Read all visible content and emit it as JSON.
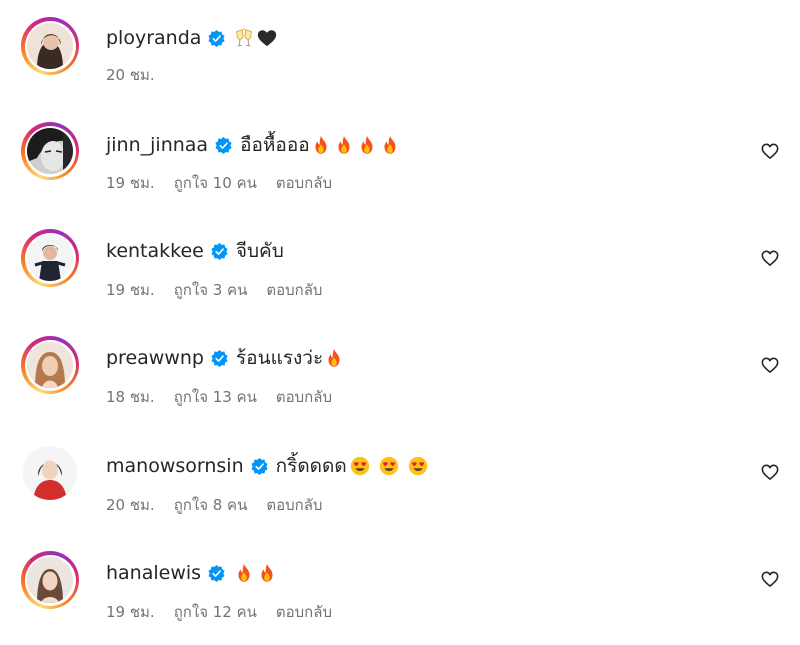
{
  "comments": [
    {
      "username": "ployranda",
      "verified": true,
      "text": "",
      "emojis": [
        "clinking-glasses",
        "black-heart"
      ],
      "time": "20 ชม.",
      "likes": "",
      "reply": "",
      "story_ring": true,
      "has_heart": false
    },
    {
      "username": "jinn_jinnaa",
      "verified": true,
      "text": "อือหื้อออ",
      "emojis": [
        "fire",
        "fire",
        "fire",
        "fire"
      ],
      "time": "19 ชม.",
      "likes": "ถูกใจ 10 คน",
      "reply": "ตอบกลับ",
      "story_ring": true,
      "has_heart": true
    },
    {
      "username": "kentakkee",
      "verified": true,
      "text": "จีบคับ",
      "emojis": [],
      "time": "19 ชม.",
      "likes": "ถูกใจ 3 คน",
      "reply": "ตอบกลับ",
      "story_ring": true,
      "has_heart": true
    },
    {
      "username": "preawwnp",
      "verified": true,
      "text": "ร้อนแรงว่ะ",
      "emojis": [
        "fire"
      ],
      "time": "18 ชม.",
      "likes": "ถูกใจ 13 คน",
      "reply": "ตอบกลับ",
      "story_ring": true,
      "has_heart": true
    },
    {
      "username": "manowsornsin",
      "verified": true,
      "text": "กริ้ดดดด",
      "emojis": [
        "heart-eyes",
        "heart-eyes",
        "heart-eyes"
      ],
      "time": "20 ชม.",
      "likes": "ถูกใจ 8 คน",
      "reply": "ตอบกลับ",
      "story_ring": false,
      "has_heart": true
    },
    {
      "username": "hanalewis",
      "verified": true,
      "text": "",
      "emojis": [
        "fire",
        "fire"
      ],
      "time": "19 ชม.",
      "likes": "ถูกใจ 12 คน",
      "reply": "ตอบกลับ",
      "story_ring": true,
      "has_heart": true
    }
  ],
  "colors": {
    "verified": "#0095f6",
    "meta": "#737373",
    "text": "#262626"
  },
  "icons": {
    "verified": "verified-badge-icon",
    "like": "heart-outline-icon"
  }
}
